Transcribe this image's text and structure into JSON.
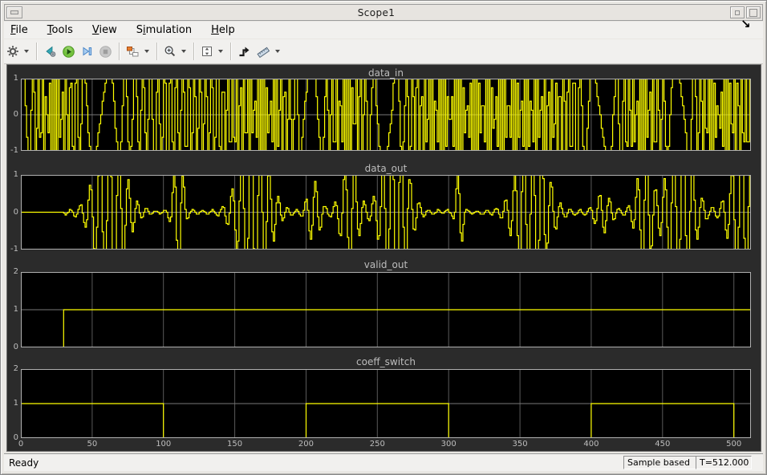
{
  "window": {
    "title": "Scope1"
  },
  "menus": [
    {
      "label": "File",
      "mnemonic": 0
    },
    {
      "label": "Tools",
      "mnemonic": 0
    },
    {
      "label": "View",
      "mnemonic": 0
    },
    {
      "label": "Simulation",
      "mnemonic": 1
    },
    {
      "label": "Help",
      "mnemonic": 0
    }
  ],
  "toolbar": {
    "buttons": [
      {
        "name": "parameters",
        "icon": "gear-icon",
        "dropdown": true
      },
      {
        "name": "step-back",
        "icon": "step-back-icon"
      },
      {
        "name": "run",
        "icon": "run-icon"
      },
      {
        "name": "step-forward",
        "icon": "step-forward-icon"
      },
      {
        "name": "stop",
        "icon": "stop-icon",
        "disabled": true
      },
      {
        "name": "signal-selector",
        "icon": "signal-selector-icon",
        "dropdown": true
      },
      {
        "name": "zoom",
        "icon": "zoom-in-icon",
        "dropdown": true
      },
      {
        "name": "fit-to-view",
        "icon": "fit-axes-icon",
        "dropdown": true
      },
      {
        "name": "triggers",
        "icon": "trigger-icon"
      },
      {
        "name": "measurements",
        "icon": "ruler-icon",
        "dropdown": true
      }
    ]
  },
  "scope": {
    "background": "#2b2b2b",
    "plot_background": "#000000",
    "grid_color": "#5a5a5a",
    "midgrid_color": "#787878",
    "border_color": "#b0b0b0",
    "trace_color": "#ffff00",
    "title_color": "#bdbdbd",
    "tick_color": "#bdbdbd",
    "xlim": [
      0,
      512
    ],
    "xticks": [
      0,
      50,
      100,
      150,
      200,
      250,
      300,
      350,
      400,
      450,
      500
    ]
  },
  "chart_data": [
    {
      "type": "line",
      "title": "data_in",
      "color": "#ffff00",
      "xlim": [
        0,
        512
      ],
      "ylim": [
        -1,
        1
      ],
      "yticks": [
        1,
        0,
        -1
      ],
      "grid": true,
      "signal": {
        "kind": "fm_staircase",
        "description": "Full-scale stair-stepped FM waveform sweeping between slow ramps and fast toggles from -1 to 1",
        "n": 512,
        "seed": 7,
        "freq_min": 0.22,
        "freq_max": 2.9,
        "slow_period": 96,
        "wobble": 223,
        "quant": 8
      }
    },
    {
      "type": "line",
      "title": "data_out",
      "color": "#ffff00",
      "xlim": [
        0,
        512
      ],
      "ylim": [
        -1,
        1
      ],
      "yticks": [
        1,
        0,
        -1
      ],
      "grid": true,
      "signal": {
        "kind": "bursts",
        "description": "Filter output: zero until t=30, then low ripple with clipped oscillation bursts",
        "n": 512,
        "seed": 3,
        "start": 30,
        "carrier": 0.95,
        "fm": 0.6,
        "base": 0.05,
        "bursts": [
          {
            "c": 62,
            "w": 9,
            "a": 2.3
          },
          {
            "c": 110,
            "w": 3,
            "a": 1.7
          },
          {
            "c": 163,
            "w": 9,
            "a": 2.4
          },
          {
            "c": 205,
            "w": 4,
            "a": 0.8
          },
          {
            "c": 230,
            "w": 5,
            "a": 1.5
          },
          {
            "c": 262,
            "w": 8,
            "a": 2.1
          },
          {
            "c": 307,
            "w": 2,
            "a": 1.2
          },
          {
            "c": 358,
            "w": 9,
            "a": 2.4
          },
          {
            "c": 408,
            "w": 5,
            "a": 0.5
          },
          {
            "c": 437,
            "w": 5,
            "a": 1.4
          },
          {
            "c": 462,
            "w": 8,
            "a": 2.1
          },
          {
            "c": 505,
            "w": 7,
            "a": 1.9
          }
        ]
      }
    },
    {
      "type": "line",
      "title": "valid_out",
      "color": "#ffff00",
      "xlim": [
        0,
        512
      ],
      "ylim": [
        0,
        2
      ],
      "yticks": [
        2,
        1,
        0
      ],
      "grid": true,
      "signal": {
        "kind": "steps",
        "points": [
          [
            0,
            0
          ],
          [
            30,
            1
          ],
          [
            512,
            1
          ]
        ]
      }
    },
    {
      "type": "line",
      "title": "coeff_switch",
      "color": "#ffff00",
      "xlim": [
        0,
        512
      ],
      "ylim": [
        0,
        2
      ],
      "yticks": [
        2,
        1,
        0
      ],
      "grid": true,
      "signal": {
        "kind": "steps",
        "points": [
          [
            0,
            1
          ],
          [
            100,
            0
          ],
          [
            200,
            1
          ],
          [
            300,
            0
          ],
          [
            400,
            1
          ],
          [
            500,
            0
          ],
          [
            512,
            0
          ]
        ]
      }
    }
  ],
  "statusbar": {
    "left": "Ready",
    "mode": "Sample based",
    "time": "T=512.000"
  }
}
